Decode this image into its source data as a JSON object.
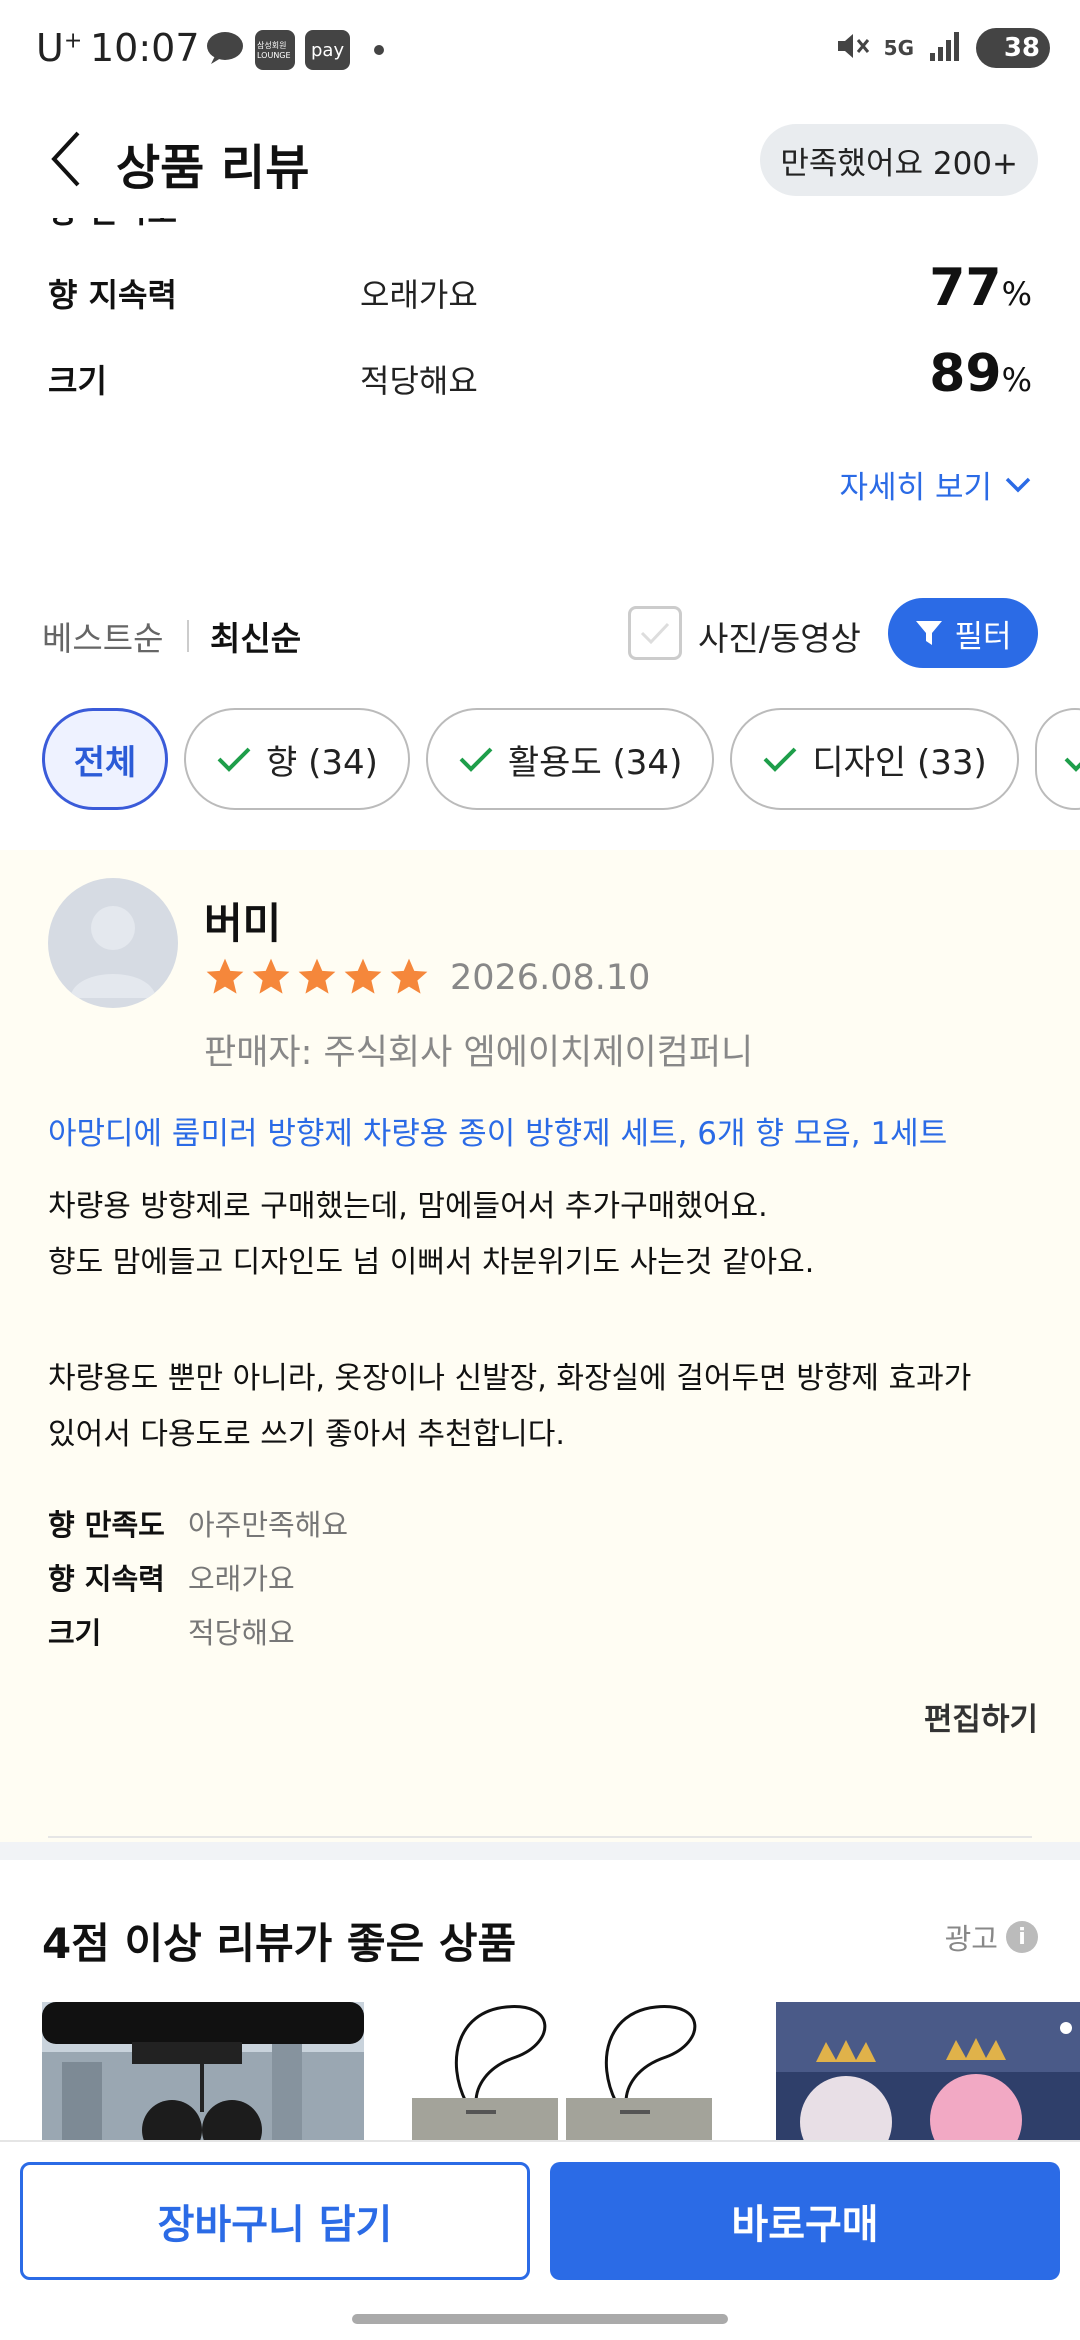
{
  "status_bar": {
    "carrier": "U",
    "carrier_plus": "+",
    "time": "10:07",
    "chip_lounge": "삼성회원 LOUNGE",
    "chip_pay": "pay",
    "network": "5G",
    "battery": "38"
  },
  "header": {
    "title": "상품 리뷰",
    "satisfied_pill": "만족했어요 200+"
  },
  "summary": {
    "partial_name": "향 만족도",
    "rows": [
      {
        "name": "향 지속력",
        "value": "오래가요",
        "percent": "77",
        "unit": "%"
      },
      {
        "name": "크기",
        "value": "적당해요",
        "percent": "89",
        "unit": "%"
      }
    ],
    "detail_link": "자세히 보기"
  },
  "sort": {
    "best": "베스트순",
    "newest": "최신순",
    "photo_video": "사진/동영상",
    "filter": "필터"
  },
  "chips": [
    {
      "label": "전체",
      "active": true
    },
    {
      "label": "향 (34)",
      "active": false
    },
    {
      "label": "활용도 (34)",
      "active": false
    },
    {
      "label": "디자인 (33)",
      "active": false
    }
  ],
  "review": {
    "reviewer": "버미",
    "rating": 5,
    "date": "2026.08.10",
    "seller": "판매자: 주식회사 엠에이치제이컴퍼니",
    "product": "아망디에 룸미러 방향제 차량용 종이 방향제 세트, 6개 향 모음, 1세트",
    "text_lines": [
      "차량용 방향제로 구매했는데, 맘에들어서 추가구매했어요.",
      "향도 맘에들고 디자인도 넘 이뻐서 차분위기도 사는것 같아요.",
      "차량용도 뿐만 아니라, 옷장이나 신발장, 화장실에 걸어두면 방향제 효과가",
      "있어서 다용도로 쓰기 좋아서 추천합니다."
    ],
    "attributes": [
      {
        "name": "향 만족도",
        "value": "아주만족해요"
      },
      {
        "name": "향 지속력",
        "value": "오래가요"
      },
      {
        "name": "크기",
        "value": "적당해요"
      }
    ],
    "edit": "편집하기"
  },
  "recommend": {
    "title": "4점 이상 리뷰가 좋은 상품",
    "ad_label": "광고",
    "info_icon": "i"
  },
  "bottom": {
    "cart": "장바구니 담기",
    "buy": "바로구매"
  },
  "colors": {
    "accent": "#2b6be6",
    "star": "#f5873b",
    "review_bg": "#fffdf3"
  }
}
